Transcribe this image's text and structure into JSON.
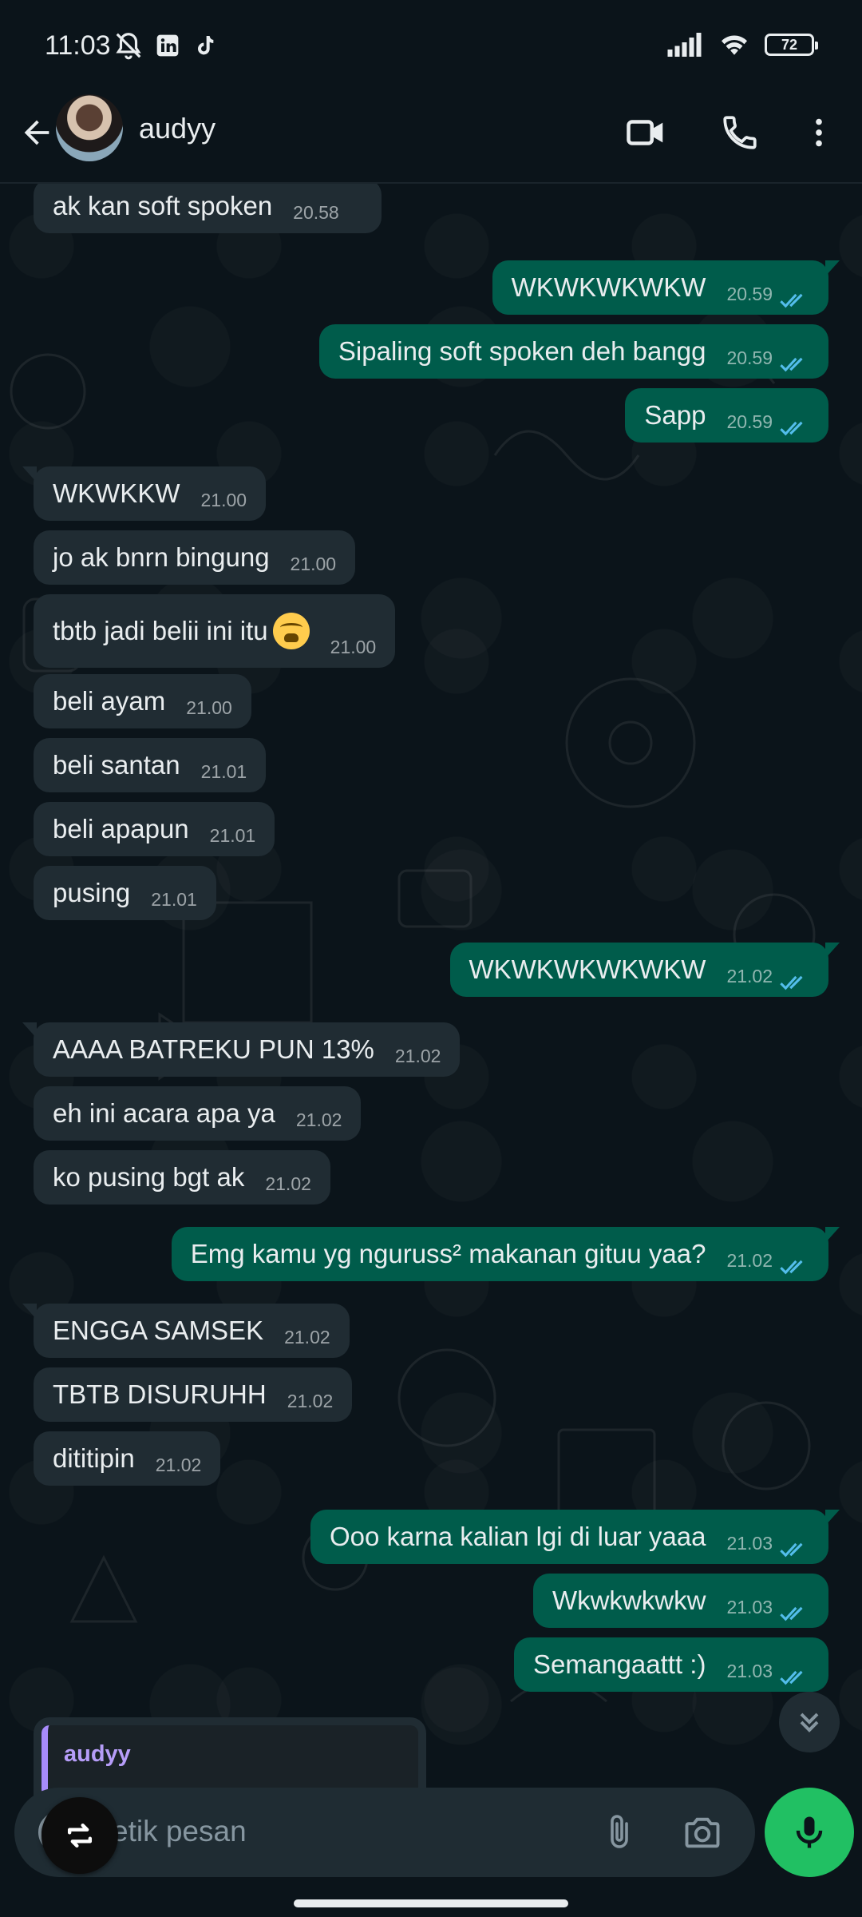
{
  "status_bar": {
    "time": "11:03",
    "battery": "72"
  },
  "header": {
    "contact_name": "audyy"
  },
  "messages": [
    {
      "dir": "in",
      "text": "ak kan soft spoken",
      "time": "20.58"
    },
    {
      "dir": "out",
      "text": "WKWKWKWKW",
      "time": "20.59",
      "read": true
    },
    {
      "dir": "out",
      "text": "Sipaling soft spoken deh bangg",
      "time": "20.59",
      "read": true
    },
    {
      "dir": "out",
      "text": "Sapp",
      "time": "20.59",
      "read": true
    },
    {
      "dir": "in",
      "text": "WKWKKW",
      "time": "21.00"
    },
    {
      "dir": "in",
      "text": "jo ak bnrn bingung",
      "time": "21.00"
    },
    {
      "dir": "in",
      "text": "tbtb jadi belii ini itu",
      "time": "21.00",
      "emoji": "tired-face"
    },
    {
      "dir": "in",
      "text": "beli ayam",
      "time": "21.00"
    },
    {
      "dir": "in",
      "text": "beli santan",
      "time": "21.01"
    },
    {
      "dir": "in",
      "text": "beli apapun",
      "time": "21.01"
    },
    {
      "dir": "in",
      "text": "pusing",
      "time": "21.01"
    },
    {
      "dir": "out",
      "text": "WKWKWKWKWKW",
      "time": "21.02",
      "read": true
    },
    {
      "dir": "in",
      "text": "AAAA BATREKU PUN 13%",
      "time": "21.02"
    },
    {
      "dir": "in",
      "text": "eh ini acara apa ya",
      "time": "21.02"
    },
    {
      "dir": "in",
      "text": "ko pusing bgt ak",
      "time": "21.02"
    },
    {
      "dir": "out",
      "text": "Emg kamu yg nguruss² makanan gituu yaa?",
      "time": "21.02",
      "read": true
    },
    {
      "dir": "in",
      "text": "ENGGA SAMSEK",
      "time": "21.02"
    },
    {
      "dir": "in",
      "text": "TBTB DISURUHH",
      "time": "21.02"
    },
    {
      "dir": "in",
      "text": "dititipin",
      "time": "21.02"
    },
    {
      "dir": "out",
      "text": "Ooo karna kalian lgi di luar yaaa",
      "time": "21.03",
      "read": true
    },
    {
      "dir": "out",
      "text": "Wkwkwkwkw",
      "time": "21.03",
      "read": true
    },
    {
      "dir": "out",
      "text": "Semangaattt :)",
      "time": "21.03",
      "read": true
    }
  ],
  "reply_preview": {
    "name": "audyy"
  },
  "composer": {
    "placeholder": "etik pesan"
  },
  "colors": {
    "background": "#0b141a",
    "incoming_bubble": "#202c33",
    "outgoing_bubble": "#005c4b",
    "read_ticks": "#53bdeb",
    "mic_button": "#21c063",
    "reply_accent": "#a78bfa"
  },
  "icons": {
    "back": "arrow-left-icon",
    "video": "video-camera-icon",
    "call": "phone-icon",
    "more": "more-vert-icon",
    "attach": "paperclip-icon",
    "camera": "camera-icon",
    "mic": "microphone-icon",
    "scroll": "chevron-double-down-icon"
  }
}
